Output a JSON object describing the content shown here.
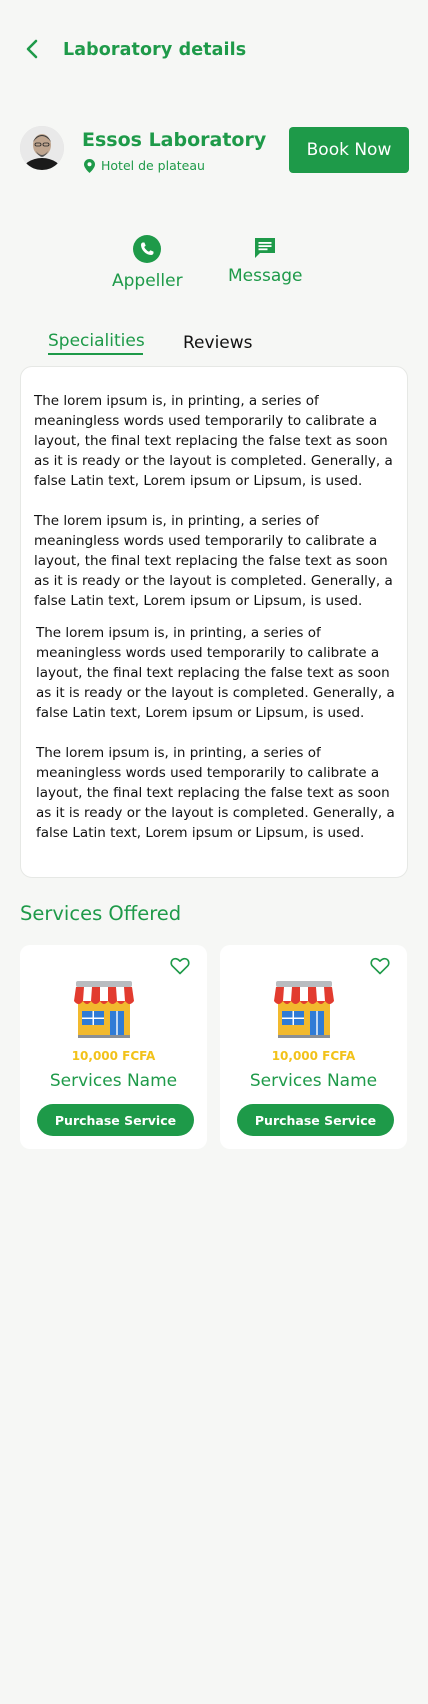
{
  "header": {
    "title": "Laboratory details"
  },
  "lab": {
    "name": "Essos Laboratory",
    "location": "Hotel de plateau",
    "book_label": "Book Now"
  },
  "actions": [
    {
      "label": "Appeller",
      "icon": "phone-icon"
    },
    {
      "label": "Message",
      "icon": "message-icon"
    }
  ],
  "tabs": [
    {
      "label": "Specialities",
      "active": true
    },
    {
      "label": "Reviews",
      "active": false
    }
  ],
  "paragraphs": [
    "The lorem ipsum is, in printing, a series of meaningless words used temporarily to calibrate a layout, the final text replacing the false text as soon as it is ready or the layout is completed. Generally, a false Latin text, Lorem ipsum or Lipsum, is used.",
    "The lorem ipsum is, in printing, a series of meaningless words used temporarily to calibrate a layout, the final text replacing the false text as soon as it is ready or the layout is completed. Generally, a false Latin text, Lorem ipsum or Lipsum, is used.",
    "The lorem ipsum is, in printing, a series of meaningless words used temporarily to calibrate a layout, the final text replacing the false text as soon as it is ready or the layout is completed. Generally, a false Latin text, Lorem ipsum or Lipsum, is used.",
    "The lorem ipsum is, in printing, a series of meaningless words used temporarily to calibrate a layout, the final text replacing the false text as soon as it is ready or the layout is completed. Generally, a false Latin text, Lorem ipsum or Lipsum, is used."
  ],
  "services": {
    "title": "Services Offered",
    "items": [
      {
        "price": "10,000 FCFA",
        "name": "Services Name",
        "button": "Purchase Service"
      },
      {
        "price": "10,000 FCFA",
        "name": "Services Name",
        "button": "Purchase Service"
      }
    ]
  },
  "colors": {
    "primary": "#1e9a49",
    "price": "#f2c21a",
    "background": "#f6f7f5"
  }
}
